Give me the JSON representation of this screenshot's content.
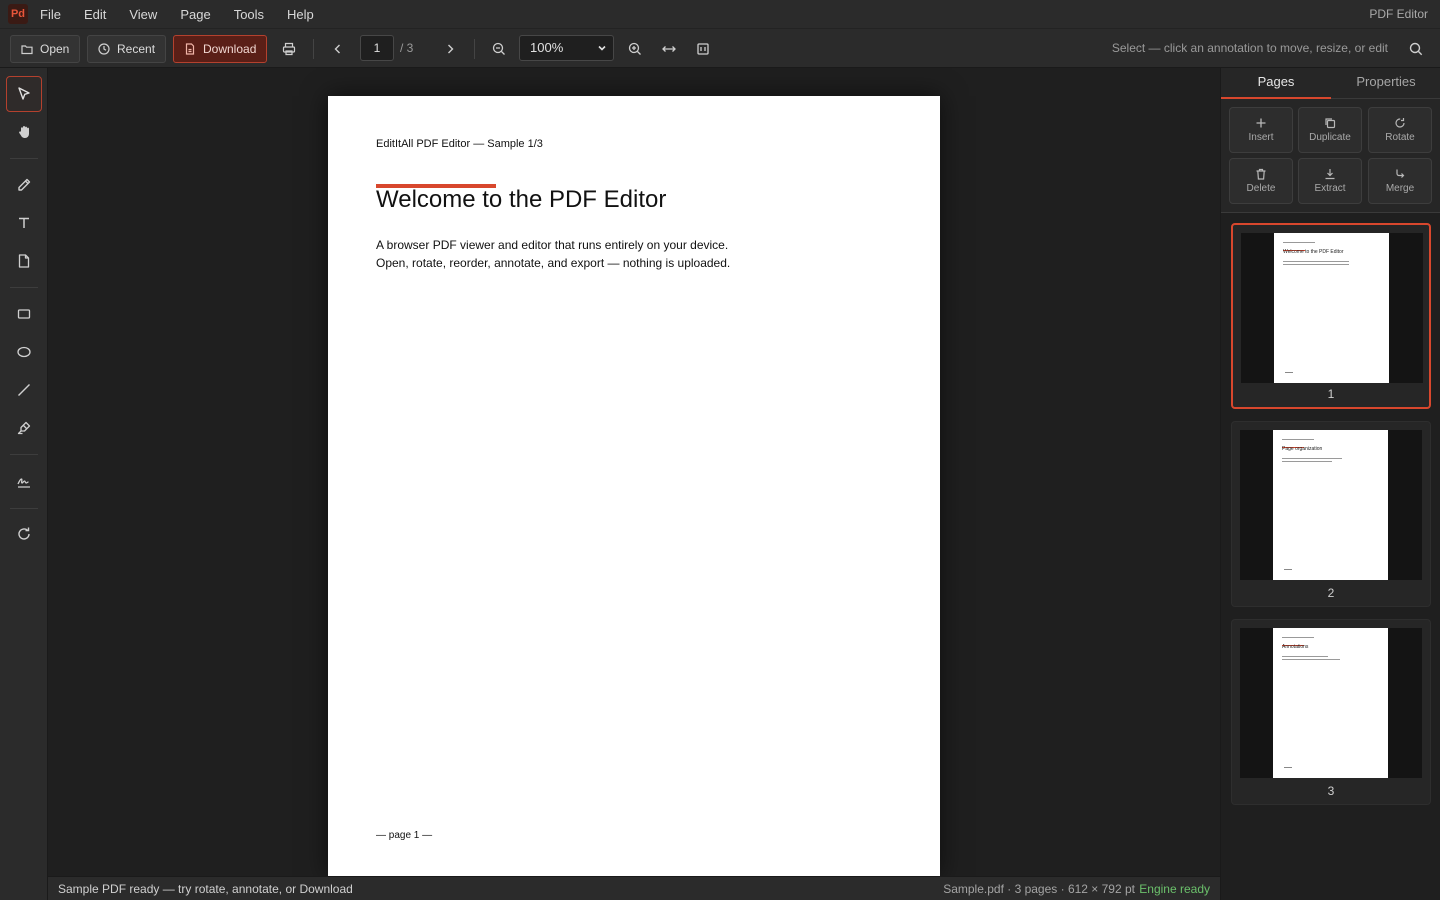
{
  "app": {
    "logo": "Pd",
    "title": "PDF Editor",
    "accent_color": "#d8472d"
  },
  "menu": [
    "File",
    "Edit",
    "View",
    "Page",
    "Tools",
    "Help"
  ],
  "toolbar": {
    "open_label": "Open",
    "recent_label": "Recent",
    "download_label": "Download",
    "current_page": "1",
    "total_pages": "/ 3",
    "zoom": "100%",
    "hint": "Select — click an annotation to move, resize, or edit"
  },
  "tools": [
    "select-icon",
    "hand-icon",
    "pen-icon",
    "text-icon",
    "note-icon",
    "rectangle-icon",
    "ellipse-icon",
    "line-icon",
    "highlighter-icon",
    "signature-icon",
    "rotate-icon"
  ],
  "page": {
    "header": "EditItAll PDF Editor — Sample 1/3",
    "title": "Welcome to the PDF Editor",
    "body_line1": "A browser PDF viewer and editor that runs entirely on your device.",
    "body_line2": "Open, rotate, reorder, annotate, and export — nothing is uploaded.",
    "footer": "— page 1 —"
  },
  "panel": {
    "tabs": [
      "Pages",
      "Properties"
    ],
    "actions": [
      "Insert",
      "Duplicate",
      "Rotate",
      "Delete",
      "Extract",
      "Merge"
    ],
    "thumbnails": [
      {
        "number": "1",
        "title": "Welcome to the PDF Editor"
      },
      {
        "number": "2",
        "title": "Page organization"
      },
      {
        "number": "3",
        "title": "Annotations"
      }
    ]
  },
  "status": {
    "message": "Sample PDF ready — try rotate, annotate, or Download",
    "doc_info": "Sample.pdf · 3 pages · 612 × 792 pt",
    "engine": "Engine ready"
  }
}
